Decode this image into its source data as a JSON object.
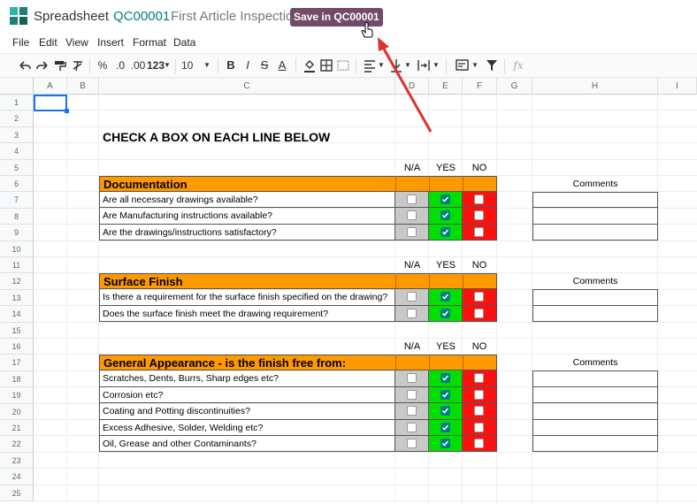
{
  "header": {
    "app_name": "Spreadsheet",
    "doc_id": "QC00001",
    "doc_title": "First Article Inspection",
    "save_label": "Save in QC00001"
  },
  "menu": [
    "File",
    "Edit",
    "View",
    "Insert",
    "Format",
    "Data"
  ],
  "toolbar": {
    "percent": "%",
    "decrease_decimal": ".0",
    "increase_decimal": ".00",
    "more_formats": "123",
    "font_size": "10",
    "bold": "B",
    "italic": "I",
    "strike": "S",
    "text_color": "A",
    "fx": "fx"
  },
  "grid": {
    "columns": [
      "A",
      "B",
      "C",
      "D",
      "E",
      "F",
      "G",
      "H",
      "I"
    ],
    "rows": [
      "1",
      "2",
      "3",
      "4",
      "5",
      "6",
      "7",
      "8",
      "9",
      "10",
      "11",
      "12",
      "13",
      "14",
      "15",
      "16",
      "17",
      "18",
      "19",
      "20",
      "21",
      "22",
      "23",
      "24",
      "25"
    ]
  },
  "sheet": {
    "heading": "CHECK A BOX ON EACH LINE BELOW",
    "captions": {
      "na": "N/A",
      "yes": "YES",
      "no": "NO",
      "comments": "Comments"
    },
    "sections": [
      {
        "title": "Documentation",
        "questions": [
          "Are all necessary drawings available?",
          "Are Manufacturing instructions available?",
          "Are the drawings/instructions satisfactory?"
        ]
      },
      {
        "title": "Surface Finish",
        "questions": [
          "Is there a requirement for the surface finish specified on the drawing?",
          "Does the surface finish meet the drawing requirement?"
        ]
      },
      {
        "title": "General Appearance - is the finish free from:",
        "questions": [
          "Scratches, Dents, Burrs, Sharp edges etc?",
          "Corrosion etc?",
          "Coating and Potting discontinuities?",
          "Excess Adhesive, Solder, Welding etc?",
          "Oil, Grease and other Contaminants?"
        ]
      }
    ]
  },
  "colors": {
    "accent": "#017e84",
    "save_button": "#714b67",
    "section_fill": "#ff9900",
    "na_fill": "#c8c8c8",
    "yes_fill": "#00e000",
    "no_fill": "#ff1010",
    "annotation_arrow": "#e03030"
  },
  "annotation": {
    "arrow": "red-arrow-pointing-to-save-button",
    "cursor": "hand-cursor-icon"
  }
}
